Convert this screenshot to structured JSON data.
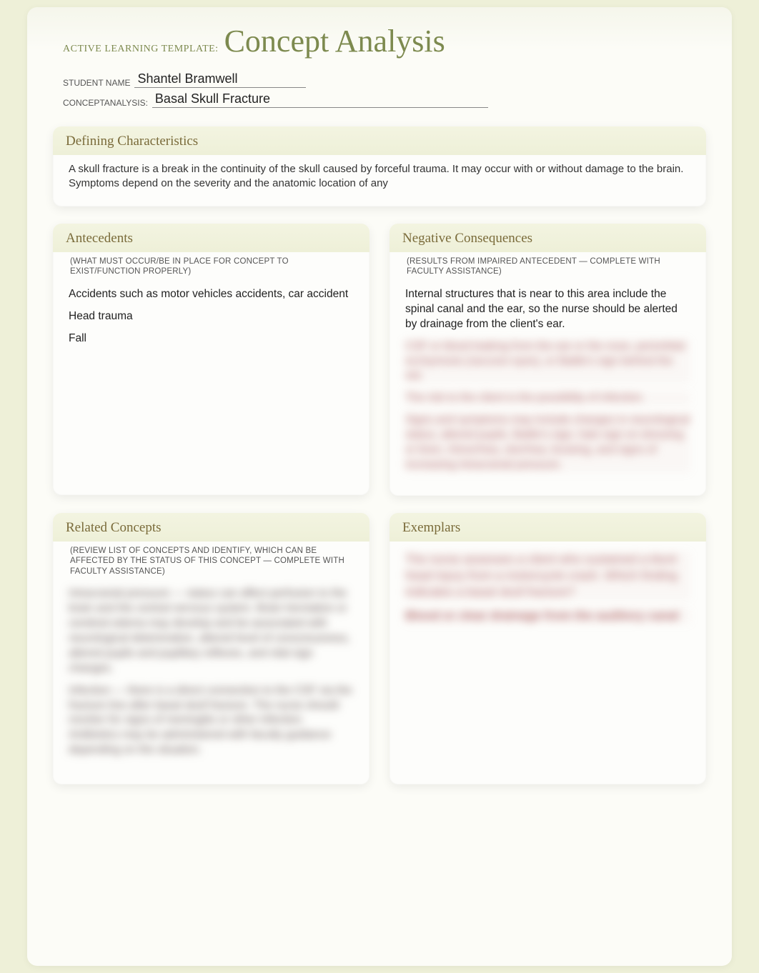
{
  "title": {
    "prefix": "ACTIVE LEARNING TEMPLATE:",
    "main": "Concept Analysis"
  },
  "meta": {
    "student_label": "STUDENT NAME",
    "student_value": "Shantel Bramwell",
    "concept_label": "CONCEPTANALYSIS:",
    "concept_value": "Basal Skull Fracture"
  },
  "defining": {
    "header": "Defining Characteristics",
    "body": "A skull fracture is a break in the continuity of the skull caused by forceful trauma. It may occur with or without damage to the brain. Symptoms depend on the severity and the anatomic location of any"
  },
  "antecedents": {
    "header": "Antecedents",
    "sub": "(WHAT MUST OCCUR/BE IN PLACE FOR CONCEPT TO EXIST/FUNCTION PROPERLY)",
    "p1": "Accidents such as motor vehicles accidents, car accident",
    "p2": "Head trauma",
    "p3": "Fall"
  },
  "negative": {
    "header": "Negative Consequences",
    "sub": "(RESULTS FROM IMPAIRED ANTECEDENT — COMPLETE WITH FACULTY ASSISTANCE)",
    "p1": "Internal structures that is near to this area include the spinal canal and the ear, so the nurse should be alerted by drainage from the client's ear.",
    "blur1": "CSF or blood leaking from the ear or the nose, periorbital ecchymosis (raccoon eyes), or Battle’s sign behind the ear.",
    "blur2": "The risk to the client is the possibility of infection.",
    "blur3": "Signs and symptoms may include changes in neurological status, altered pupils, Battle’s sign, halo sign on dressing or linen, rhinorrhea, otorrhea, bruising, and signs of increasing intracranial pressure."
  },
  "related": {
    "header": "Related Concepts",
    "sub": "(REVIEW LIST OF CONCEPTS AND IDENTIFY, WHICH CAN BE AFFECTED BY THE STATUS OF THIS CONCEPT — COMPLETE WITH FACULTY ASSISTANCE)",
    "blur1": "Intracranial pressure — status can affect perfusion to the brain and the central nervous system. Brain herniation or cerebral edema may develop and be associated with neurological deterioration, altered level of consciousness, altered pupils and pupillary reflexes, and vital sign changes.",
    "blur2": "Infection — there is a direct connection to the CSF via the fracture line after basal skull fracture. The nurse should monitor for signs of meningitis or other infection. Antibiotics may be administered with faculty guidance depending on the situation."
  },
  "exemplars": {
    "header": "Exemplars",
    "blur1": "The nurse assesses a client who sustained a blunt head injury from a motorcycle crash. Which finding indicates a basal skull fracture?",
    "blur2": "Blood or clear drainage from the auditory canal"
  }
}
